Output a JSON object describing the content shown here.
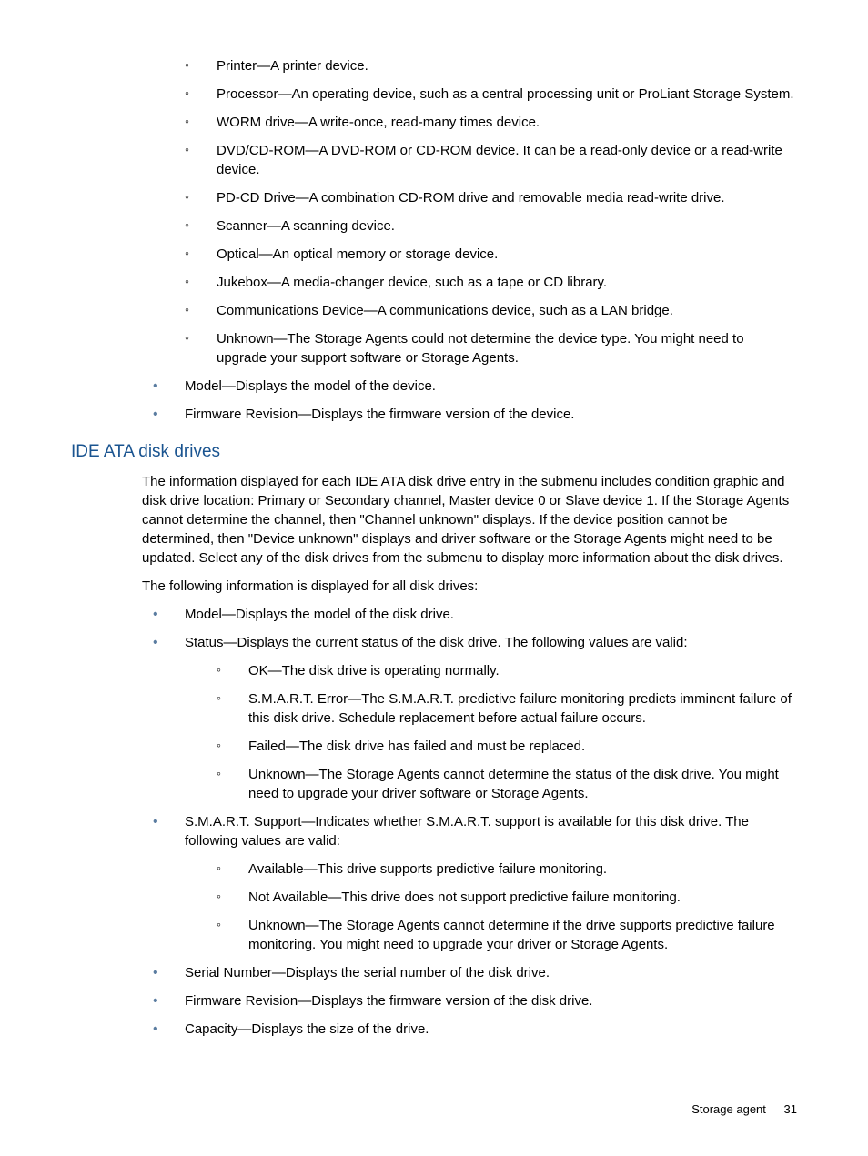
{
  "top_circle_list": [
    "Printer—A printer device.",
    "Processor—An operating device, such as a central processing unit or ProLiant Storage System.",
    "WORM drive—A write-once, read-many times device.",
    "DVD/CD-ROM—A DVD-ROM or CD-ROM device. It can be a read-only device or a read-write device.",
    "PD-CD Drive—A combination CD-ROM drive and removable media read-write drive.",
    "Scanner—A scanning device.",
    "Optical—An optical memory or storage device.",
    "Jukebox—A media-changer device, such as a tape or CD library.",
    "Communications Device—A communications device, such as a LAN bridge.",
    "Unknown—The Storage Agents could not determine the device type. You might need to upgrade your support software or Storage Agents."
  ],
  "top_bullet_list": [
    "Model—Displays the model of the device.",
    "Firmware Revision—Displays the firmware version of the device."
  ],
  "heading": "IDE ATA disk drives",
  "para1": "The information displayed for each IDE ATA disk drive entry in the submenu includes condition graphic and disk drive location: Primary or Secondary channel, Master device 0 or Slave device 1. If the Storage Agents cannot determine the channel, then \"Channel unknown\" displays. If the device position cannot be determined, then \"Device unknown\" displays and driver software or the Storage Agents might need to be updated. Select any of the disk drives from the submenu to display more information about the disk drives.",
  "para2": "The following information is displayed for all disk drives:",
  "main_bullets": {
    "b0": "Model—Displays the model of the disk drive.",
    "b1": "Status—Displays the current status of the disk drive. The following values are valid:",
    "b1_subs": [
      "OK—The disk drive is operating normally.",
      "S.M.A.R.T. Error—The S.M.A.R.T. predictive failure monitoring predicts imminent failure of this disk drive. Schedule replacement before actual failure occurs.",
      "Failed—The disk drive has failed and must be replaced.",
      "Unknown—The Storage Agents cannot determine the status of the disk drive. You might need to upgrade your driver software or Storage Agents."
    ],
    "b2": "S.M.A.R.T. Support—Indicates whether S.M.A.R.T. support is available for this disk drive. The following values are valid:",
    "b2_subs": [
      "Available—This drive supports predictive failure monitoring.",
      "Not Available—This drive does not support predictive failure monitoring.",
      "Unknown—The Storage Agents cannot determine if the drive supports predictive failure monitoring. You might need to upgrade your driver or Storage Agents."
    ],
    "b3": "Serial Number—Displays the serial number of the disk drive.",
    "b4": "Firmware Revision—Displays the firmware version of the disk drive.",
    "b5": "Capacity—Displays the size of the drive."
  },
  "footer_text": "Storage agent",
  "footer_page": "31"
}
